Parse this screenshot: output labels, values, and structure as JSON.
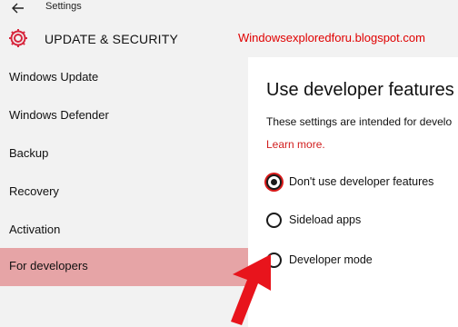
{
  "window": {
    "title": "Settings",
    "back_icon": "back-arrow-icon"
  },
  "header": {
    "icon": "gear-icon",
    "title": "UPDATE & SECURITY",
    "watermark": "Windowsexploredforu.blogspot.com",
    "accent_color": "#d7263d",
    "watermark_color": "#e00000"
  },
  "sidebar": {
    "items": [
      {
        "label": "Windows Update",
        "selected": false
      },
      {
        "label": "Windows Defender",
        "selected": false
      },
      {
        "label": "Backup",
        "selected": false
      },
      {
        "label": "Recovery",
        "selected": false
      },
      {
        "label": "Activation",
        "selected": false
      },
      {
        "label": "For developers",
        "selected": true
      }
    ],
    "selected_color": "#e6a4a6"
  },
  "main": {
    "title": "Use developer features",
    "description": "These settings are intended for develo",
    "learn_more": "Learn more.",
    "options": [
      {
        "label": "Don't use developer features",
        "checked": true
      },
      {
        "label": "Sideload apps",
        "checked": false
      },
      {
        "label": "Developer mode",
        "checked": false
      }
    ]
  },
  "annotation": {
    "arrow_color": "#e8141c"
  }
}
